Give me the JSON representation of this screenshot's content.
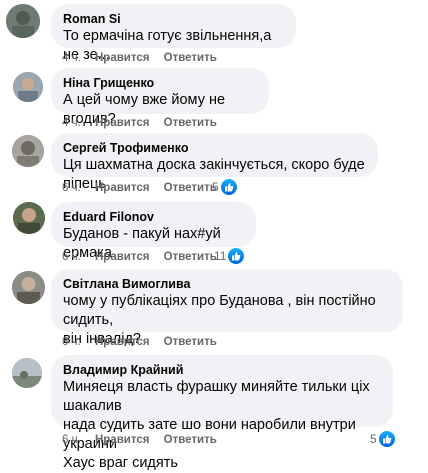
{
  "comments": [
    {
      "author": "Roman Si",
      "text": "То ермачіна готує звільнення,а не зе...",
      "time": "4 ч.",
      "like_label": "Нравится",
      "reply_label": "Ответить",
      "reactions": ""
    },
    {
      "author": "Ніна Грищенко",
      "text": "А цей чому вже йому не вгодив?",
      "time": "4 ч.",
      "like_label": "Нравится",
      "reply_label": "Ответить",
      "reactions": ""
    },
    {
      "author": "Сергей Трофименко",
      "text": "Ця шахматна доска закінчується, скоро буде піпець",
      "time": "6 ч.",
      "like_label": "Нравится",
      "reply_label": "Ответить",
      "reactions": "5"
    },
    {
      "author": "Eduard Filonov",
      "text": "Буданов - пакуй нах#уй ермака",
      "time": "6 ч.",
      "like_label": "Нравится",
      "reply_label": "Ответить",
      "reactions": "11"
    },
    {
      "author": "Світлана Вимоглива",
      "text_lines": [
        "чому у публікаціях про Буданова , він постійно сидить,",
        "він інвалід?"
      ],
      "time": "6 ч.",
      "like_label": "Нравится",
      "reply_label": "Ответить",
      "reactions": ""
    },
    {
      "author": "Владимир Крайний",
      "text_lines": [
        "Миняеця власть фурашку миняйте тильки ціх шакалив",
        "нада судить зате шо вони наробили внутри украини",
        "Хаус враг сидять"
      ],
      "time": "6 ч.",
      "like_label": "Нравится",
      "reply_label": "Ответить",
      "reactions": "5"
    }
  ],
  "colors": {
    "bubble": "#f0f2f5",
    "meta": "#65676b",
    "like_blue": "#0062df"
  }
}
